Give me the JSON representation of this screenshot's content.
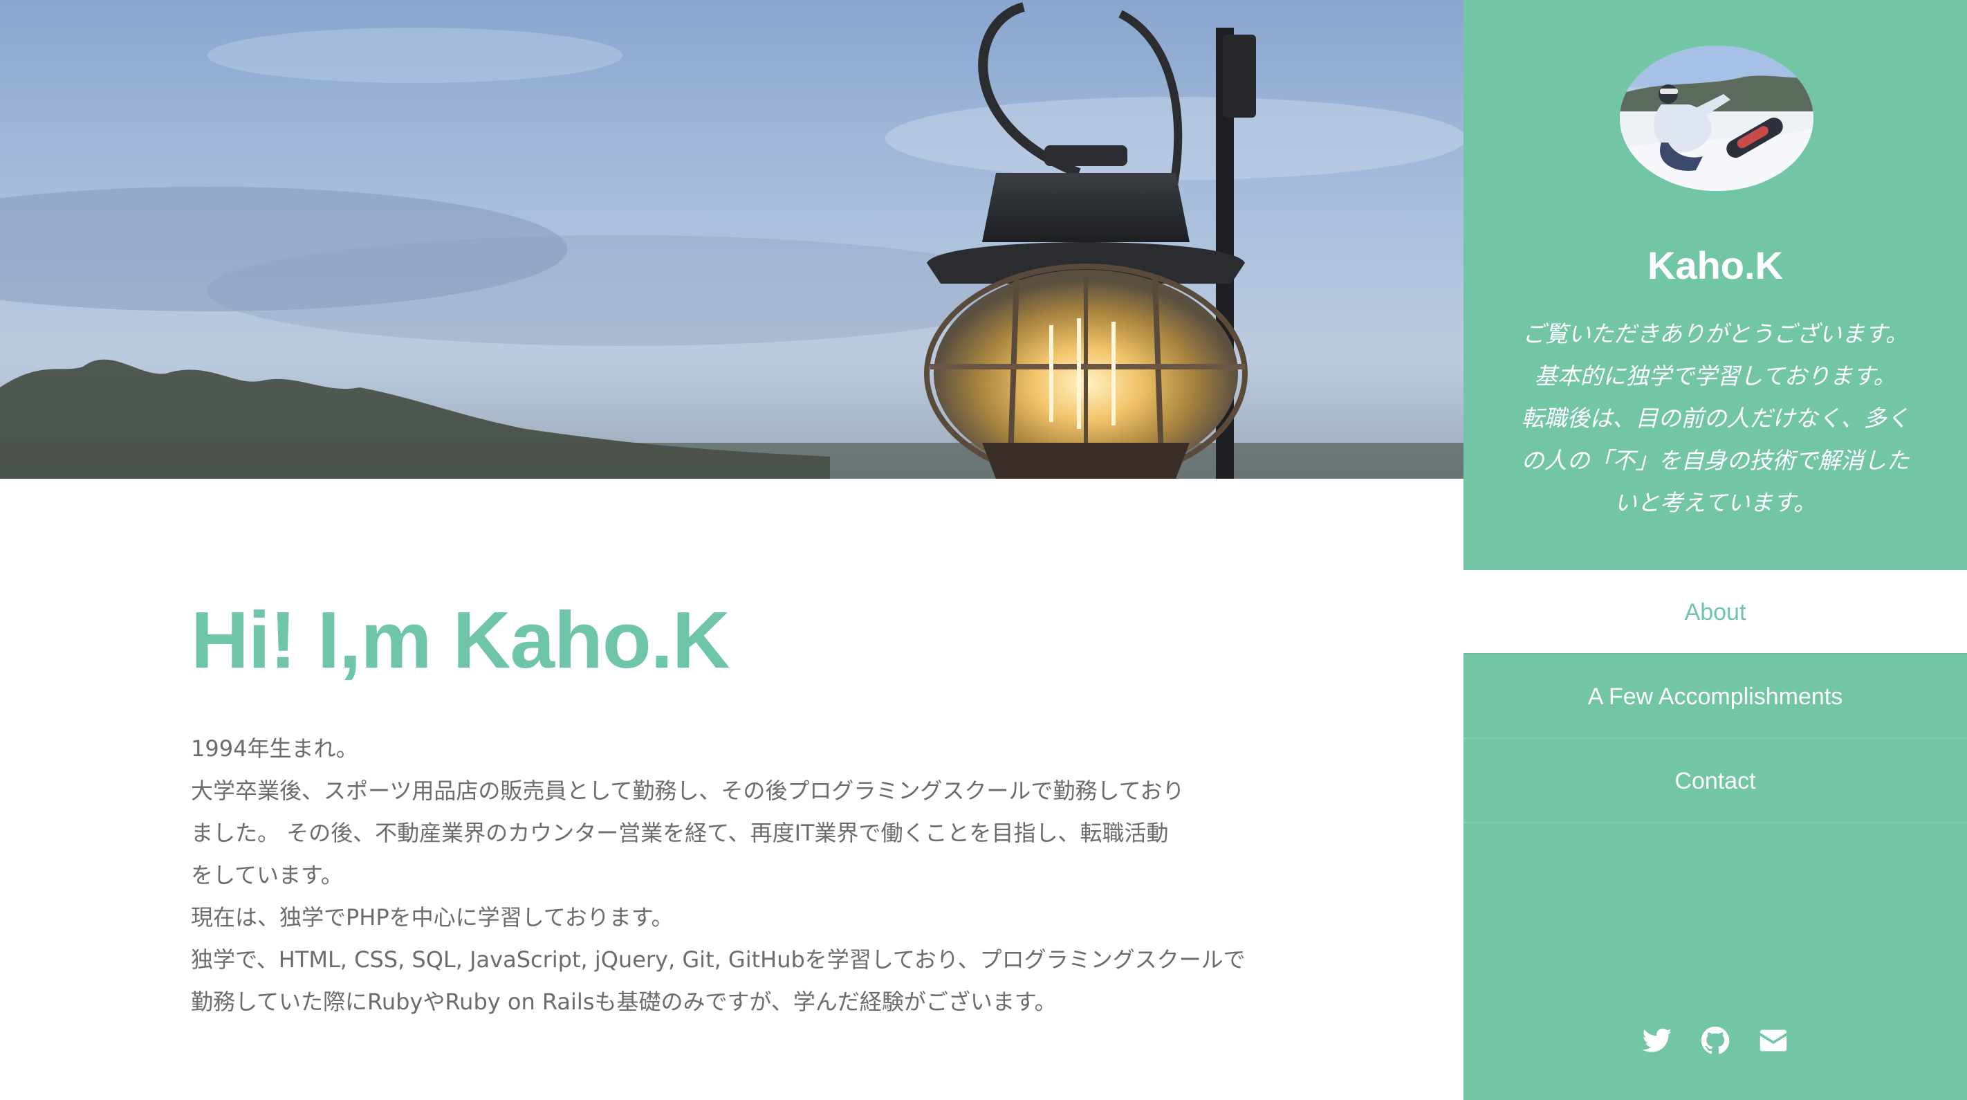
{
  "main": {
    "heading": "Hi! I,m Kaho.K",
    "intro_lines": [
      "1994年生まれ。",
      "大学卒業後、スポーツ用品店の販売員として勤務し、その後プログラミングスクールで勤務しており",
      "ました。 その後、不動産業界のカウンター営業を経て、再度IT業界で働くことを目指し、転職活動",
      "をしています。",
      "現在は、独学でPHPを中心に学習しております。",
      "独学で、HTML, CSS, SQL, JavaScript, jQuery, Git, GitHubを学習しており、プログラミングスクールで",
      "勤務していた際にRubyやRuby on Railsも基礎のみですが、学んだ経験がございます。"
    ]
  },
  "sidebar": {
    "name": "Kaho.K",
    "bio_lines": [
      "ご覧いただきありがとうございます。",
      "基本的に独学で学習しております。",
      "転職後は、目の前の人だけなく、多く",
      "の人の「不」を自身の技術で解消した",
      "いと考えています。"
    ],
    "nav": [
      {
        "label": "About",
        "active": true
      },
      {
        "label": "A Few Accomplishments",
        "active": false
      },
      {
        "label": "Contact",
        "active": false
      }
    ],
    "social_icons": [
      "twitter-icon",
      "github-icon",
      "envelope-icon"
    ]
  },
  "colors": {
    "accent": "#6fc6a6",
    "sidebar_bg": "#72c6a6",
    "body_text": "#6c6c6c",
    "white": "#ffffff"
  }
}
